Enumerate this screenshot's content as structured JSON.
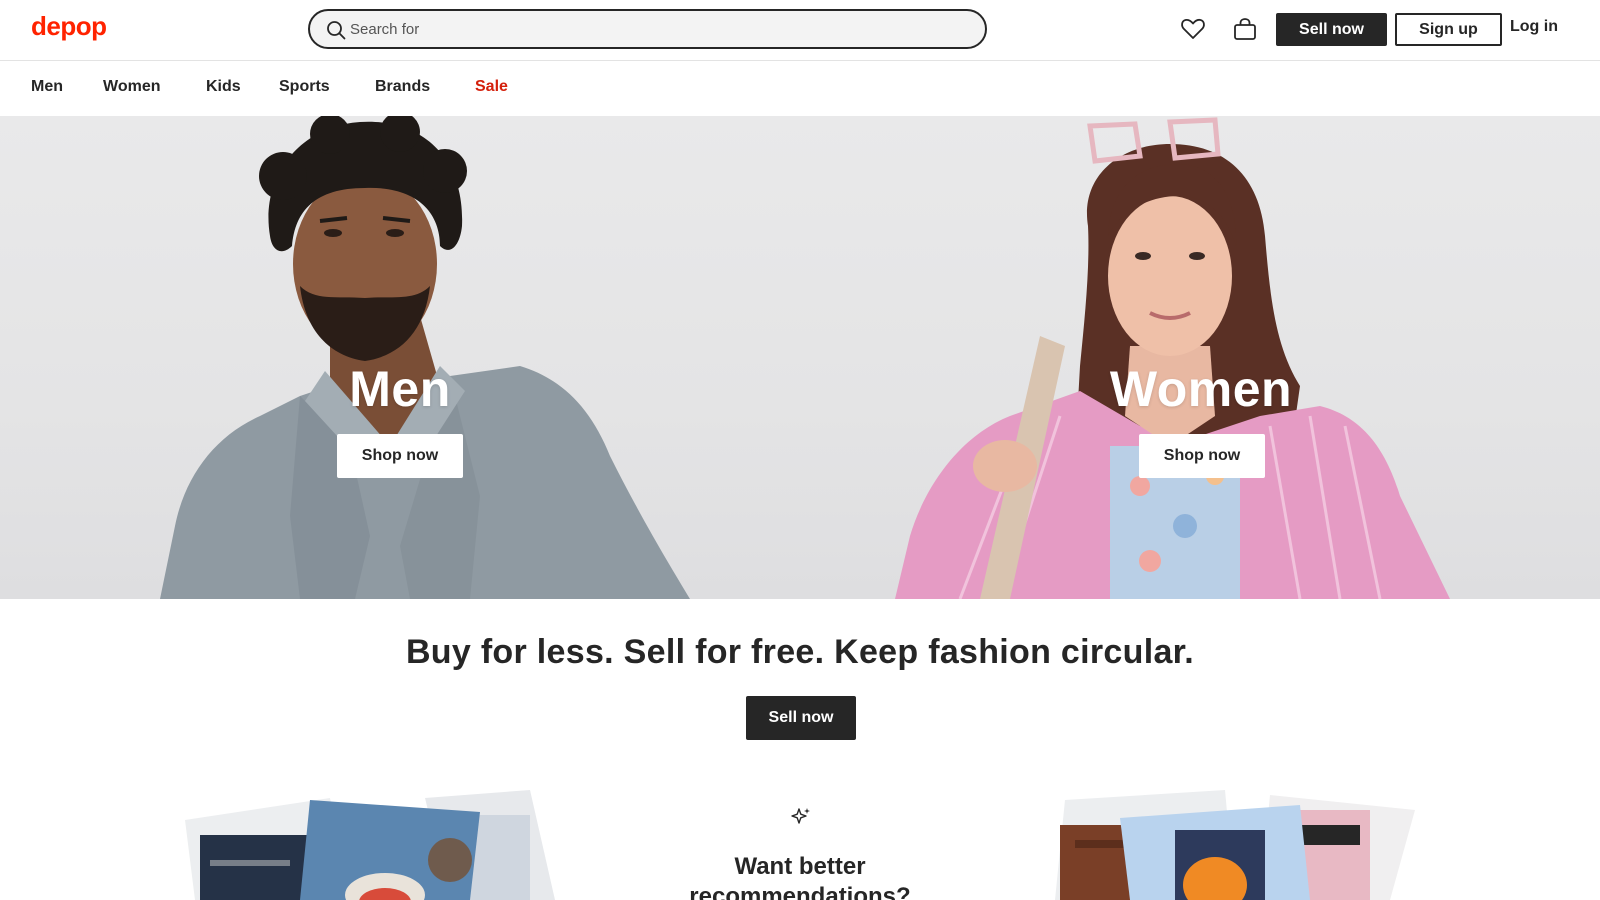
{
  "header": {
    "logo": "depop",
    "search_placeholder": "Search for",
    "sell_label": "Sell now",
    "signup_label": "Sign up",
    "login_label": "Log in"
  },
  "nav": {
    "items": [
      {
        "label": "Men"
      },
      {
        "label": "Women"
      },
      {
        "label": "Kids"
      },
      {
        "label": "Sports"
      },
      {
        "label": "Brands"
      },
      {
        "label": "Sale"
      }
    ]
  },
  "hero": {
    "men": {
      "title": "Men",
      "cta": "Shop now"
    },
    "women": {
      "title": "Women",
      "cta": "Shop now"
    }
  },
  "promo": {
    "tagline": "Buy for less. Sell for free. Keep fashion circular.",
    "cta": "Sell now"
  },
  "recommendations": {
    "heading_line1": "Want better",
    "heading_line2": "recommendations?"
  },
  "colors": {
    "brand": "#ff2300",
    "sale": "#d4200c",
    "dark": "#262626"
  },
  "icons": [
    "search-icon",
    "heart-icon",
    "bag-icon",
    "sparkle-icon"
  ]
}
